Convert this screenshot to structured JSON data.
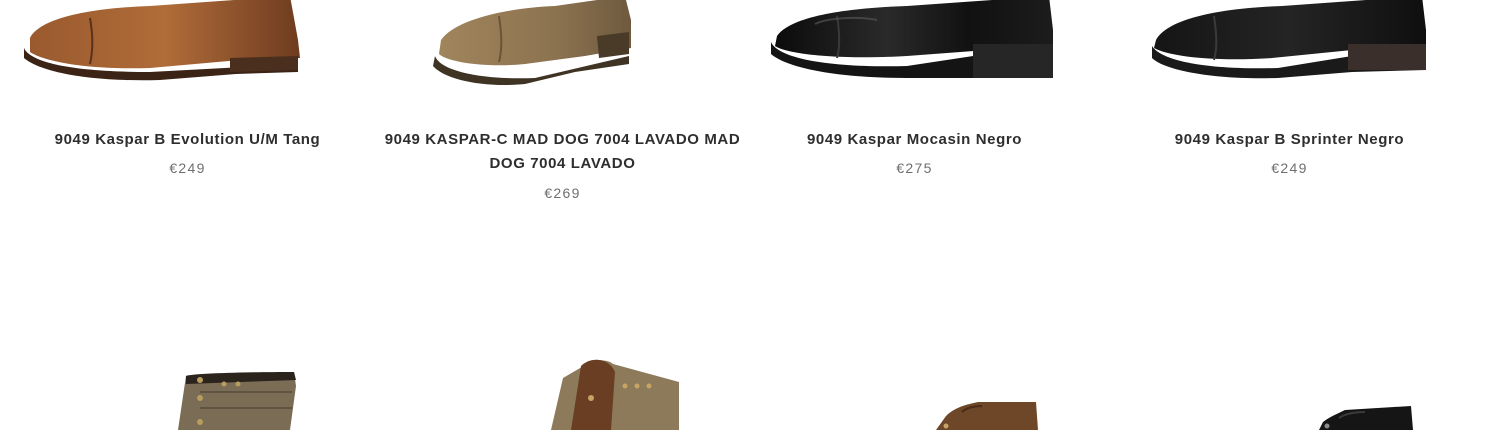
{
  "products": [
    {
      "name": "9049 Kaspar B Evolution U/M Tang",
      "price": "€249",
      "image": "brown-leather-cap-toe-shoe"
    },
    {
      "name": "9049 KASPAR-C MAD DOG 7004 LAVADO MAD DOG 7004 LAVADO",
      "price": "€269",
      "image": "tan-suede-cap-toe-shoe"
    },
    {
      "name": "9049 Kaspar Mocasin Negro",
      "price": "€275",
      "image": "black-polished-cap-toe-shoe"
    },
    {
      "name": "9049 Kaspar B Sprinter Negro",
      "price": "€249",
      "image": "black-matte-cap-toe-shoe"
    }
  ],
  "next_row": [
    {
      "image": "grey-canvas-boot"
    },
    {
      "image": "brown-canvas-leather-boot"
    },
    {
      "image": "brown-leather-chukka-boot"
    },
    {
      "image": "black-leather-chukka-boot"
    }
  ],
  "colors": {
    "brown": "#7a4a2a",
    "tan": "#8c7350",
    "black": "#121212"
  }
}
